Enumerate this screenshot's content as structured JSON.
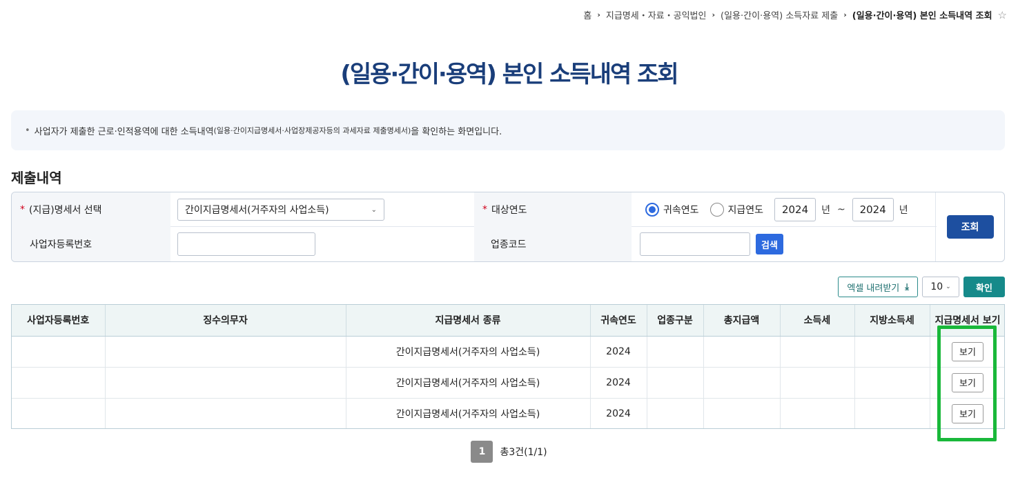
{
  "breadcrumb": {
    "items": [
      "홈",
      "지급명세・자료・공익법인",
      "(일용·간이·용역) 소득자료 제출",
      "(일용·간이·용역) 본인 소득내역 조회"
    ]
  },
  "page": {
    "title": "(일용·간이·용역) 본인 소득내역 조회",
    "notice_main": "사업자가 제출한 근로·인적용역에 대한 소득내역",
    "notice_small": "(일용·간이지급명세서·사업장제공자등의 과세자료 제출명세서)",
    "notice_end": "을 확인하는 화면입니다.",
    "section_title": "제출내역"
  },
  "search": {
    "statement_label": "(지급)명세서 선택",
    "statement_value": "간이지급명세서(거주자의 사업소득)",
    "year_label": "대상연도",
    "radio_attribution": "귀속연도",
    "radio_payment": "지급연도",
    "year_from": "2024",
    "year_to": "2024",
    "year_unit": "년",
    "tilde": "~",
    "bizno_label": "사업자등록번호",
    "bizno_value": "",
    "industry_label": "업종코드",
    "industry_value": "",
    "search_btn": "검색",
    "query_btn": "조회"
  },
  "toolbar": {
    "excel_label": "엑셀 내려받기",
    "page_size": "10",
    "confirm_label": "확인"
  },
  "table": {
    "headers": [
      "사업자등록번호",
      "징수의무자",
      "지급명세서 종류",
      "귀속연도",
      "업종구분",
      "총지급액",
      "소득세",
      "지방소득세",
      "지급명세서 보기"
    ],
    "rows": [
      {
        "bizno": "",
        "payer": "",
        "type": "간이지급명세서(거주자의 사업소득)",
        "year": "2024",
        "industry": "",
        "total": "",
        "tax": "",
        "local_tax": "",
        "view": "보기"
      },
      {
        "bizno": "",
        "payer": "",
        "type": "간이지급명세서(거주자의 사업소득)",
        "year": "2024",
        "industry": "",
        "total": "",
        "tax": "",
        "local_tax": "",
        "view": "보기"
      },
      {
        "bizno": "",
        "payer": "",
        "type": "간이지급명세서(거주자의 사업소득)",
        "year": "2024",
        "industry": "",
        "total": "",
        "tax": "",
        "local_tax": "",
        "view": "보기"
      }
    ]
  },
  "pagination": {
    "current": "1",
    "total_text": "총3건(1/1)"
  },
  "colors": {
    "title": "#1a3e7a",
    "primary": "#1d4fa0",
    "accent_blue": "#2d6adf",
    "teal": "#168a8a",
    "highlight": "#19b83a"
  }
}
